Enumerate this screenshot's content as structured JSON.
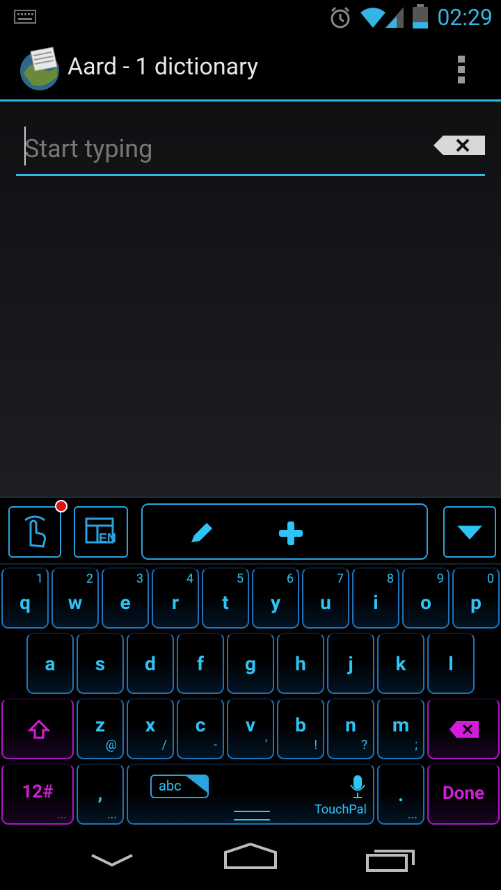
{
  "status_bar": {
    "time": "02:29"
  },
  "action_bar": {
    "title": "Aard - 1 dictionary"
  },
  "search": {
    "placeholder": "Start typing"
  },
  "keyboard": {
    "row1": [
      {
        "letter": "q",
        "num": "1"
      },
      {
        "letter": "w",
        "num": "2"
      },
      {
        "letter": "e",
        "num": "3"
      },
      {
        "letter": "r",
        "num": "4"
      },
      {
        "letter": "t",
        "num": "5"
      },
      {
        "letter": "y",
        "num": "6"
      },
      {
        "letter": "u",
        "num": "7"
      },
      {
        "letter": "i",
        "num": "8"
      },
      {
        "letter": "o",
        "num": "9"
      },
      {
        "letter": "p",
        "num": "0"
      }
    ],
    "row2": [
      "a",
      "s",
      "d",
      "f",
      "g",
      "h",
      "j",
      "k",
      "l"
    ],
    "row3": [
      {
        "letter": "z",
        "sym": "@"
      },
      {
        "letter": "x",
        "sym": "/"
      },
      {
        "letter": "c",
        "sym": "-"
      },
      {
        "letter": "v",
        "sym": "'"
      },
      {
        "letter": "b",
        "sym": "!"
      },
      {
        "letter": "n",
        "sym": "?"
      },
      {
        "letter": "m",
        "sym": ";"
      }
    ],
    "sym_key": "12#",
    "comma": ",",
    "period": ".",
    "abc": "abc",
    "touchpal": "TouchPal",
    "done": "Done",
    "ellipsis": "..."
  },
  "colors": {
    "accent": "#33b5e5",
    "key_blue": "#2ec4f5",
    "key_pink": "#d11ddb"
  }
}
